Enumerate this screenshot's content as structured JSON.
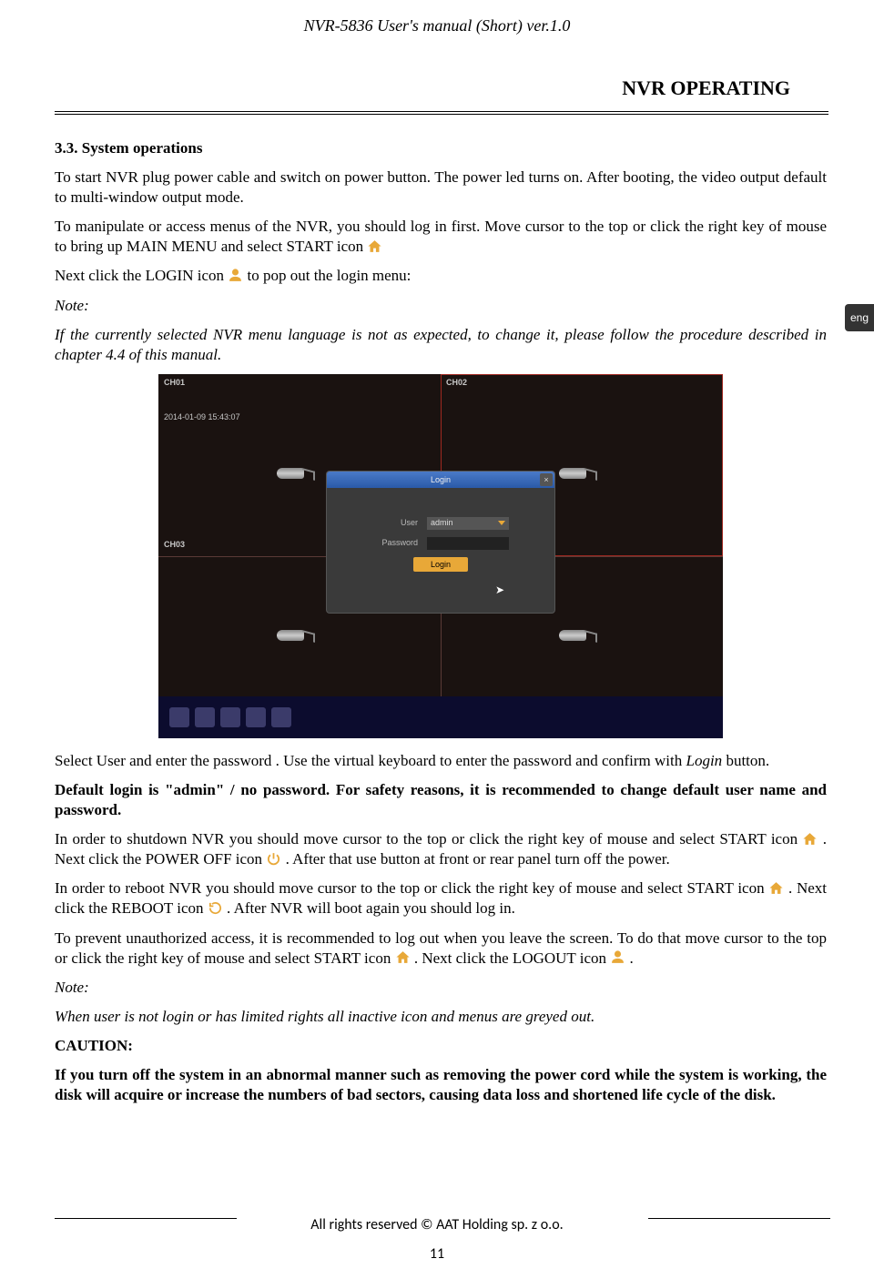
{
  "header": "NVR-5836 User's manual (Short) ver.1.0",
  "section_title": "NVR OPERATING",
  "h_sysop": "3.3. System operations",
  "p1": "To start NVR plug power cable and switch on power button. The power led turns on. After booting, the video output default to multi-window output mode.",
  "p2a": "To manipulate or access menus of the NVR, you should log in first. Move cursor to the top or click the right key of mouse to bring up MAIN MENU and select START icon ",
  "p3a": "Next click the LOGIN icon ",
  "p3b": " to pop out the login menu:",
  "note1": "Note:",
  "note1_body": "If the currently selected NVR menu language is not as expected, to change it, please follow the procedure described in chapter 4.4 of this manual.",
  "eng": "eng",
  "fig": {
    "ch01": "CH01",
    "ch02": "CH02",
    "ch03": "CH03",
    "timestamp": "2014-01-09 15:43:07",
    "login_title": "Login",
    "user_label": "User",
    "user_value": "admin",
    "pw_label": "Password",
    "login_btn": "Login"
  },
  "p4a": "Select User and enter the password . Use the virtual keyboard to enter the password and confirm with ",
  "p4b": "Login",
  "p4c": " button.",
  "p5": "Default login is \"admin\" / no password.  For safety reasons, it is recommended to change default user name and password.",
  "p6a": "In order to shutdown NVR you should move cursor to the top or click the right key of mouse and select START icon ",
  "p6b": " . Next click the POWER OFF icon ",
  "p6c": " . After that use button at front or rear panel turn off the power.",
  "p7a": "In order to  reboot NVR you should move cursor to the top or click the right key of mouse and select START icon ",
  "p7b": " . Next click the REBOOT icon ",
  "p7c": " . After NVR will boot again you should log in.",
  "p8a": "To prevent unauthorized access, it is recommended to log out when you leave the screen. To do that move cursor to the top or click the right key of mouse and select START icon ",
  "p8b": " . Next click the LOGOUT icon ",
  "p8c": " .",
  "note2": "Note:",
  "note2_body": "When user is not login or has limited rights all inactive icon and menus are greyed out.",
  "caution": "CAUTION:",
  "caution_body": "If you turn off the system in an abnormal manner such as removing the power cord while the system is working, the disk will acquire or increase the numbers of bad sectors, causing data loss and shortened life cycle of the disk.",
  "footer": "All rights reserved © AAT Holding sp. z o.o.",
  "page": "11"
}
